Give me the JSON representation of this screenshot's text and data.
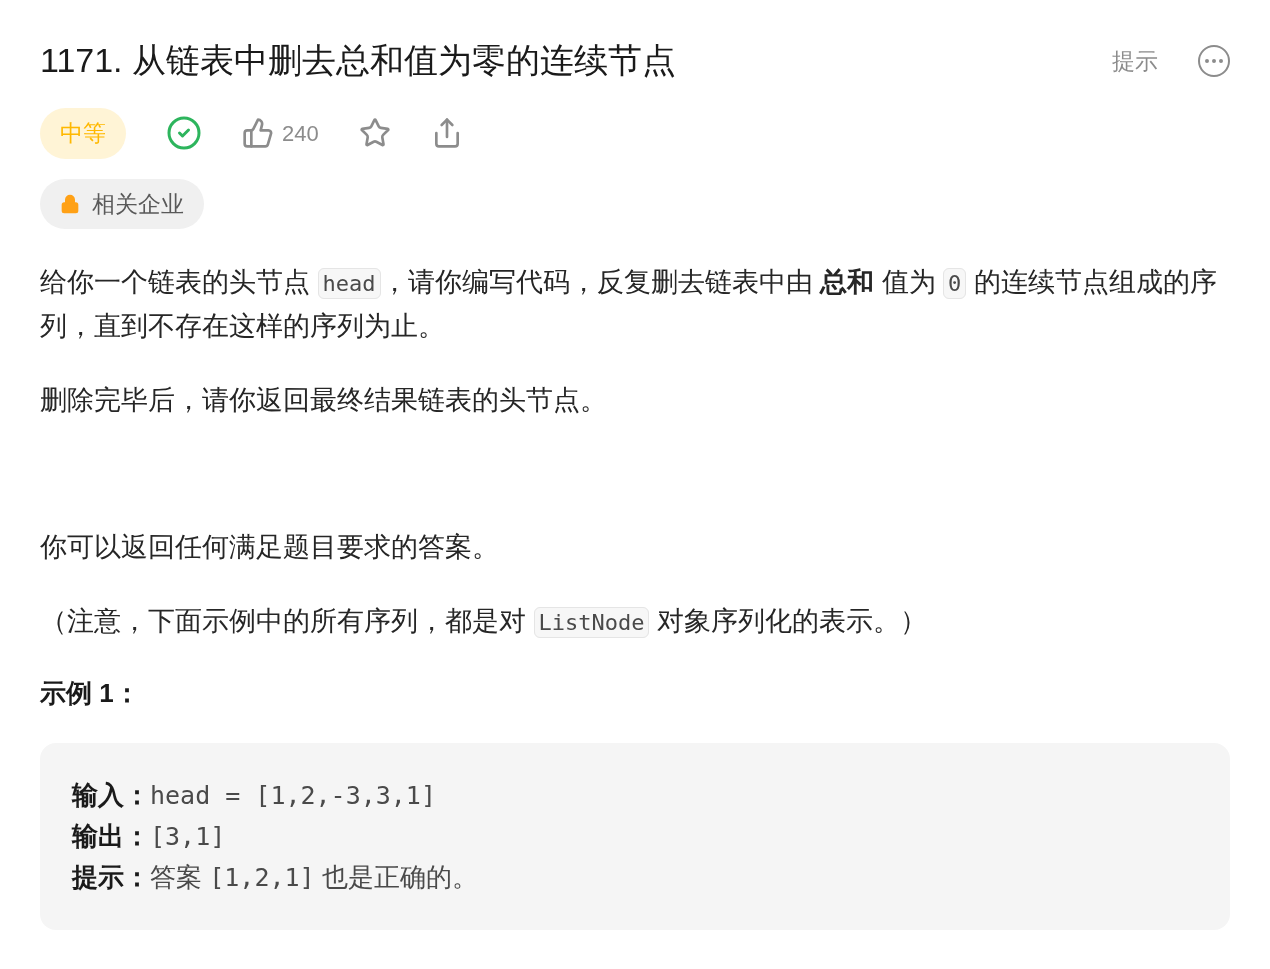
{
  "title": "1171. 从链表中删去总和值为零的连续节点",
  "hint_link": "提示",
  "difficulty": "中等",
  "solved": true,
  "likes": "240",
  "companies_tag": "相关企业",
  "paragraphs": [
    [
      {
        "kind": "text",
        "text": "给你一个链表的头节点 "
      },
      {
        "kind": "code",
        "text": "head"
      },
      {
        "kind": "text",
        "text": "，请你编写代码，反复删去链表中由 **总和** 值为 "
      },
      {
        "kind": "code",
        "text": "0"
      },
      {
        "kind": "text",
        "text": " 的连续节点组成的序列，直到不存在这样的序列为止。"
      }
    ],
    [
      {
        "kind": "text",
        "text": "删除完毕后，请你返回最终结果链表的头节点。"
      }
    ],
    [
      {
        "kind": "text",
        "text": "你可以返回任何满足题目要求的答案。"
      }
    ],
    [
      {
        "kind": "text",
        "text": "（注意，下面示例中的所有序列，都是对 "
      },
      {
        "kind": "code",
        "text": "ListNode"
      },
      {
        "kind": "text",
        "text": " 对象序列化的表示。）"
      }
    ]
  ],
  "example_title": "示例 1：",
  "example_lines": [
    {
      "label": "输入：",
      "parts": [
        {
          "kind": "mono",
          "text": "head = [1,2,-3,3,1]"
        }
      ]
    },
    {
      "label": "输出：",
      "parts": [
        {
          "kind": "mono",
          "text": "[3,1]"
        }
      ]
    },
    {
      "label": "提示：",
      "parts": [
        {
          "kind": "text",
          "text": "答案 "
        },
        {
          "kind": "mono",
          "text": "[1,2,1]"
        },
        {
          "kind": "text",
          "text": " 也是正确的。"
        }
      ]
    }
  ]
}
